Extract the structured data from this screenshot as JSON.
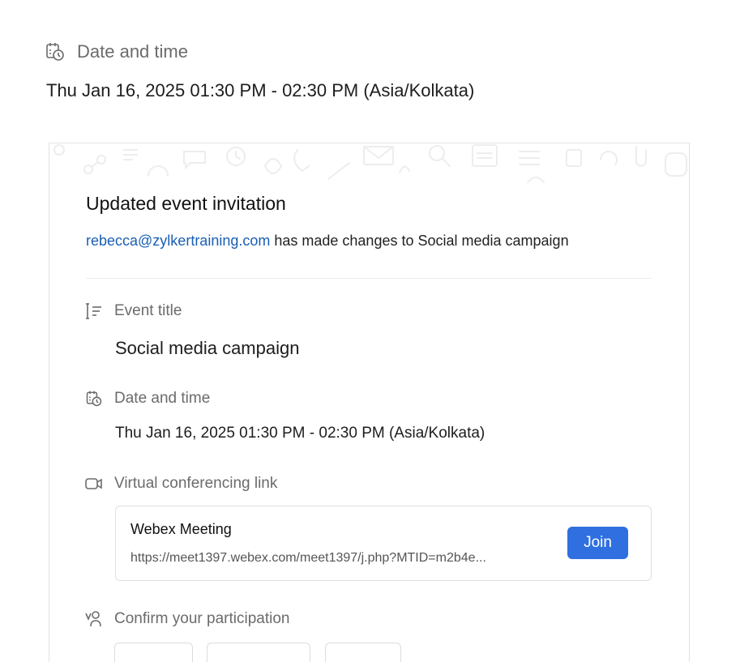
{
  "header": {
    "label": "Date and time",
    "value": "Thu Jan 16, 2025 01:30 PM - 02:30 PM (Asia/Kolkata)"
  },
  "card": {
    "title": "Updated event invitation",
    "email": "rebecca@zylkertraining.com",
    "message": " has made changes to Social media campaign",
    "event_title": {
      "label": "Event title",
      "value": "Social media campaign"
    },
    "date_time": {
      "label": "Date and time",
      "value": "Thu Jan 16, 2025 01:30 PM - 02:30 PM (Asia/Kolkata)"
    },
    "conferencing": {
      "label": "Virtual conferencing link",
      "provider": "Webex Meeting",
      "url": "https://meet1397.webex.com/meet1397/j.php?MTID=m2b4e...",
      "join_label": "Join"
    },
    "participation": {
      "label": "Confirm your participation"
    }
  },
  "colors": {
    "link": "#1a5fb4",
    "join_button": "#2f6fe0",
    "label_gray": "#6b6b6b"
  }
}
